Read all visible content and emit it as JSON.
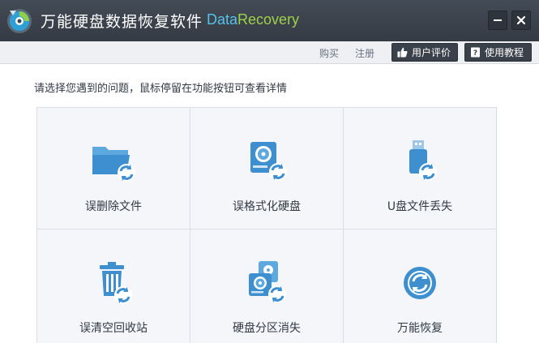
{
  "titlebar": {
    "title_cn": "万能硬盘数据恢复软件",
    "title_en_part1": "Data",
    "title_en_part2": "Recovery",
    "minimize_glyph": "—",
    "close_glyph": "✕"
  },
  "toolbar": {
    "buy_label": "购买",
    "register_label": "注册",
    "review_label": "用户评价",
    "tutorial_label": "使用教程"
  },
  "main": {
    "prompt": "请选择您遇到的问题，鼠标停留在功能按钮可查看详情",
    "tiles": [
      {
        "label": "误删除文件",
        "icon": "folder-restore-icon"
      },
      {
        "label": "误格式化硬盘",
        "icon": "harddisk-restore-icon"
      },
      {
        "label": "U盘文件丢失",
        "icon": "usb-restore-icon"
      },
      {
        "label": "误清空回收站",
        "icon": "recycle-bin-restore-icon"
      },
      {
        "label": "硬盘分区消失",
        "icon": "partition-restore-icon"
      },
      {
        "label": "万能恢复",
        "icon": "universal-restore-icon"
      }
    ]
  },
  "colors": {
    "titlebar_bg": "#3a414b",
    "brand_blue": "#56c1ea",
    "brand_green": "#9ed04a",
    "icon_blue": "#3d8fd0",
    "tile_bg": "#f4f6f9"
  }
}
